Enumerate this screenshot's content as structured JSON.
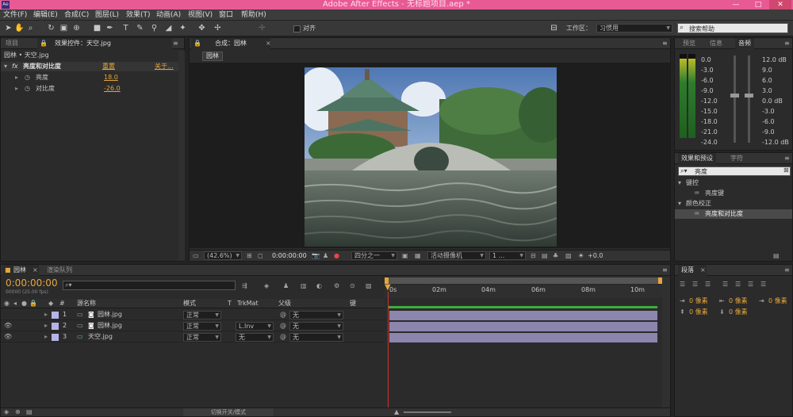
{
  "titlebar": {
    "logo": "Ae",
    "title": "Adobe After Effects - 无标题项目.aep *",
    "min": "—",
    "max": "□",
    "close": "✕"
  },
  "menus": [
    "文件(F)",
    "编辑(E)",
    "合成(C)",
    "图层(L)",
    "效果(T)",
    "动画(A)",
    "视图(V)",
    "窗口",
    "帮助(H)"
  ],
  "toolbar": {
    "snap_label": "对齐",
    "workspace_label": "工作区：",
    "workspace_value": "习惯用",
    "search_placeholder": "搜索帮助"
  },
  "left_panel": {
    "tabs": [
      "项目",
      "效果控件：天空.jpg"
    ],
    "breadcrumb": "园林 • 天空.jpg",
    "effect_name": "亮度和对比度",
    "reset": "重置",
    "about": "关于...",
    "params": [
      {
        "name": "亮度",
        "value": "18.0"
      },
      {
        "name": "对比度",
        "value": "-26.0"
      }
    ]
  },
  "comp_panel": {
    "tab": "合成：园林",
    "comp_button": "园林",
    "zoom": "(42.6%)",
    "timecode": "0:00:00:00",
    "resolution": "四分之一",
    "camera": "活动摄像机",
    "views": "1 ...",
    "exposure": "+0.0"
  },
  "right_panel": {
    "audio_tabs": [
      "预览",
      "信息",
      "音频"
    ],
    "audio_left": [
      "0.0",
      "-3.0",
      "-6.0",
      "-9.0",
      "-12.0",
      "-15.0",
      "-18.0",
      "-21.0",
      "-24.0"
    ],
    "audio_right": [
      "12.0 dB",
      "9.0",
      "6.0",
      "3.0",
      "0.0 dB",
      "-3.0",
      "-6.0",
      "-9.0",
      "-12.0 dB"
    ],
    "effects_tabs": [
      "效果和预设",
      "字符"
    ],
    "effects_search": "亮度",
    "effects_tree": [
      {
        "label": "键控",
        "type": "folder"
      },
      {
        "label": "亮度键",
        "type": "item"
      },
      {
        "label": "颜色校正",
        "type": "folder"
      },
      {
        "label": "亮度和对比度",
        "type": "item"
      }
    ],
    "paragraph_tab": "段落",
    "indent_fields": [
      "0 像素",
      "0 像素",
      "0 像素",
      "0 像素",
      "0 像素"
    ]
  },
  "timeline": {
    "tabs": [
      "园林",
      "渲染队列"
    ],
    "timecode": "0:00:00:00",
    "fps": "00000 (25.00 fps)",
    "search_placeholder": "",
    "headers": {
      "num": "#",
      "source": "源名称",
      "mode": "模式",
      "t": "T",
      "trkmat": "TrkMat",
      "parent": "父级",
      "key": "键"
    },
    "ruler": [
      "0s",
      "02m",
      "04m",
      "06m",
      "08m",
      "10m"
    ],
    "layers": [
      {
        "num": "1",
        "name": "园林.jpg",
        "mode": "正常",
        "trkmat": "",
        "parent": "无",
        "color": "#b4b4e6"
      },
      {
        "num": "2",
        "name": "园林.jpg",
        "mode": "正常",
        "trkmat": "L.Inv",
        "parent": "无",
        "color": "#b4b4e6"
      },
      {
        "num": "3",
        "name": "天空.jpg",
        "mode": "正常",
        "trkmat": "无",
        "parent": "无",
        "color": "#b4b4e6"
      }
    ],
    "footer_toggle": "切换开关/模式"
  },
  "colors": {
    "titlebar": "#e85a94",
    "accent": "#e6a63a",
    "layer_bar": "#8c85ad",
    "timeline_green": "#3fae3f",
    "playhead": "#c83232"
  }
}
